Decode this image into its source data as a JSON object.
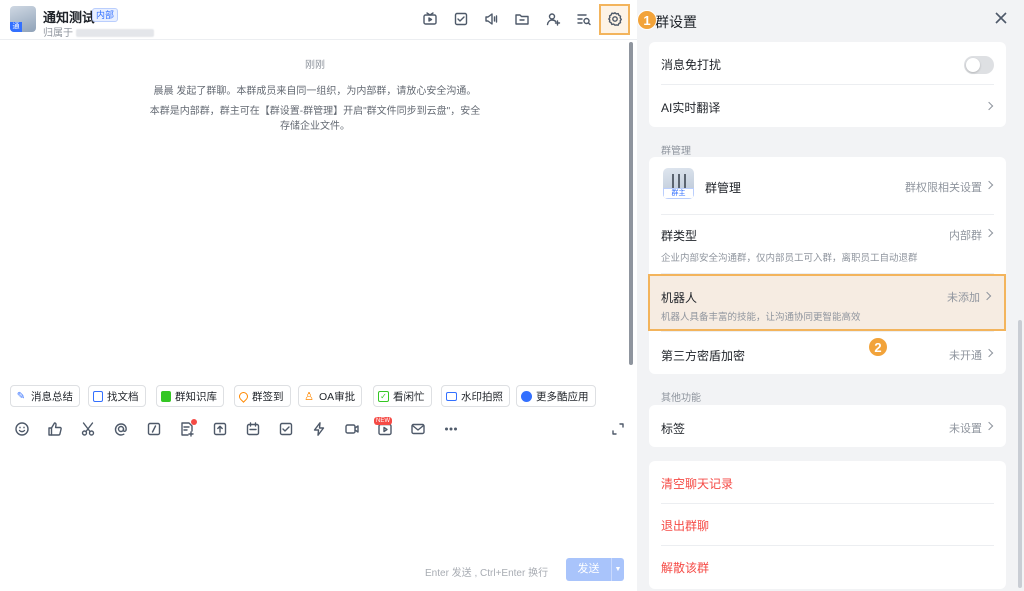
{
  "chat": {
    "group_name": "通知测试",
    "badge": "内部",
    "avatar_mini": "通",
    "belongs_prefix": "归属于",
    "header_icons": [
      "video-meeting-icon",
      "task-icon",
      "announcement-icon",
      "folder-icon",
      "add-member-icon",
      "search-history-icon",
      "settings-icon"
    ],
    "time_label": "刚刚",
    "system_message_1": "晨晨 发起了群聊。本群成员来自同一组织，为内部群，请放心安全沟通。",
    "system_message_2": "本群是内部群，群主可在【群设置-群管理】开启\"群文件同步到云盘\"，安全存储企业文件。",
    "quick_apps": [
      {
        "label": "消息总结",
        "icon": "summary-icon",
        "color": "#3370ff"
      },
      {
        "label": "找文档",
        "icon": "find-doc-icon",
        "color": "#3370ff"
      },
      {
        "label": "群知识库",
        "icon": "wiki-icon",
        "color": "#34c724"
      },
      {
        "label": "群签到",
        "icon": "checkin-icon",
        "color": "#ff8800"
      },
      {
        "label": "OA审批",
        "icon": "approval-icon",
        "color": "#ff8800"
      },
      {
        "label": "看闲忙",
        "icon": "calendar-busy-icon",
        "color": "#34c724"
      },
      {
        "label": "水印拍照",
        "icon": "camera-icon",
        "color": "#3370ff"
      },
      {
        "label": "更多酷应用",
        "icon": "more-apps-icon",
        "color": "#3370ff"
      }
    ],
    "toolbar_icons": [
      "emoji-icon",
      "like-icon",
      "scissors-icon",
      "mention-icon",
      "command-icon",
      "doc-add-icon",
      "upload-icon",
      "schedule-icon",
      "todo-icon",
      "flash-icon",
      "video-icon",
      "live-icon",
      "mail-icon",
      "more-icon",
      "expand-icon"
    ],
    "new_badge": "NEW",
    "send_hint": "Enter 发送 , Ctrl+Enter 换行",
    "send_label": "发送",
    "send_dropdown": "▼"
  },
  "panel": {
    "title": "群设置",
    "step_1": "1",
    "step_2": "2",
    "settings_top": [
      {
        "label": "消息免打扰",
        "control": "toggle",
        "state": "off"
      },
      {
        "label": "AI实时翻译"
      }
    ],
    "section_manage": "群管理",
    "manage": {
      "label": "群管理",
      "value": "群权限相关设置",
      "owner_badge": "群主"
    },
    "group_type": {
      "label": "群类型",
      "value": "内部群",
      "desc": "企业内部安全沟通群，仅内部员工可入群，离职员工自动退群"
    },
    "robot": {
      "label": "机器人",
      "value": "未添加",
      "desc": "机器人具备丰富的技能，让沟通协同更智能高效"
    },
    "encryption": {
      "label": "第三方密盾加密",
      "value": "未开通"
    },
    "section_other": "其他功能",
    "tags": {
      "label": "标签",
      "value": "未设置"
    },
    "danger": {
      "clear_history": "清空聊天记录",
      "leave_group": "退出群聊",
      "dissolve_group": "解散该群"
    }
  },
  "colors": {
    "accent": "#3370ff",
    "danger": "#f54a45",
    "highlight": "#f3b45c",
    "step_marker": "#f2a33a"
  }
}
